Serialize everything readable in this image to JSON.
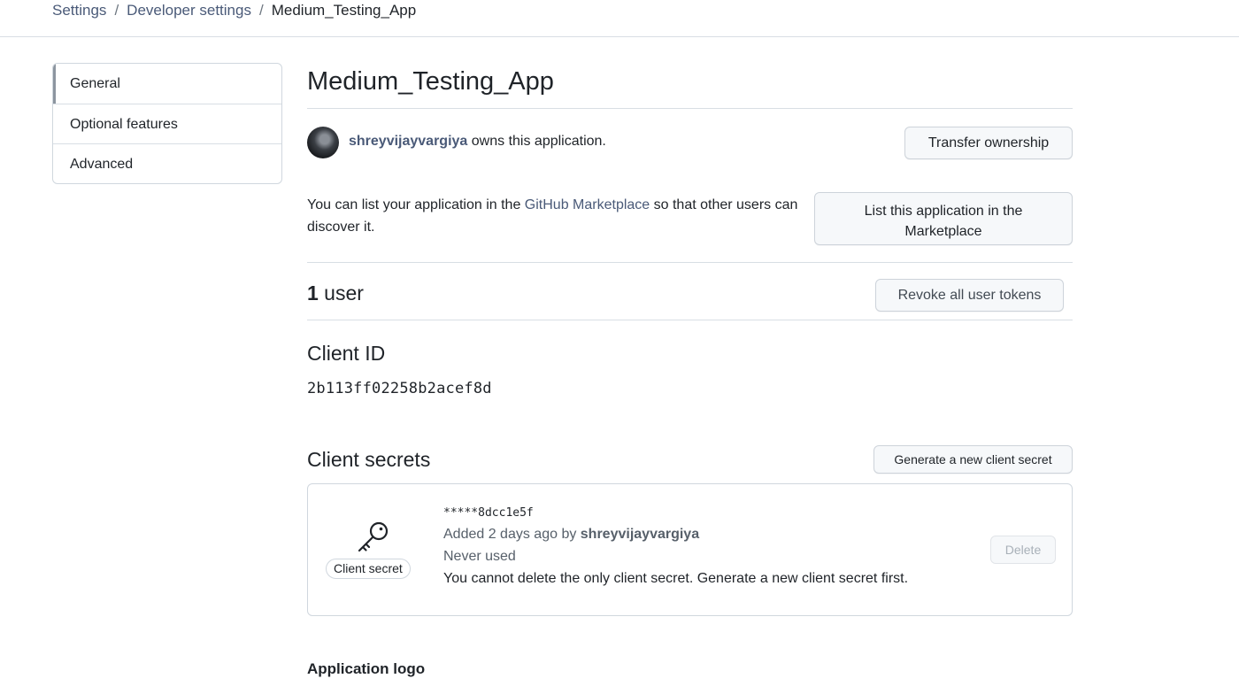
{
  "breadcrumb": {
    "items": [
      "Settings",
      "Developer settings"
    ],
    "separator": "/",
    "current": "Medium_Testing_App"
  },
  "sidebar": {
    "items": [
      {
        "label": "General",
        "active": true
      },
      {
        "label": "Optional features",
        "active": false
      },
      {
        "label": "Advanced",
        "active": false
      }
    ]
  },
  "app": {
    "title": "Medium_Testing_App",
    "owner": "shreyvijayvargiya",
    "owner_suffix": " owns this application.",
    "transfer_button": "Transfer ownership"
  },
  "marketplace": {
    "text_before": "You can list your application in the ",
    "link_text": "GitHub Marketplace",
    "text_after": " so that other users can discover it.",
    "button_line1": "List this application in the",
    "button_line2": "Marketplace"
  },
  "users": {
    "count": "1",
    "label": " user",
    "revoke_button": "Revoke all user tokens"
  },
  "client_id": {
    "heading": "Client ID",
    "value": "2b113ff02258b2acef8d"
  },
  "client_secrets": {
    "heading": "Client secrets",
    "generate_button": "Generate a new client secret",
    "secret": {
      "badge": "Client secret",
      "masked_value": "*****8dcc1e5f",
      "added_prefix": "Added 2 days ago by ",
      "added_by": "shreyvijayvargiya",
      "usage": "Never used",
      "note": "You cannot delete the only client secret. Generate a new client secret first.",
      "delete_button": "Delete",
      "icon": "key-icon"
    }
  },
  "application_logo": {
    "heading": "Application logo"
  },
  "colors": {
    "link": "#4a5a78",
    "border": "#d0d7de",
    "button_bg": "#f6f8fa",
    "muted_text": "#57606a"
  }
}
